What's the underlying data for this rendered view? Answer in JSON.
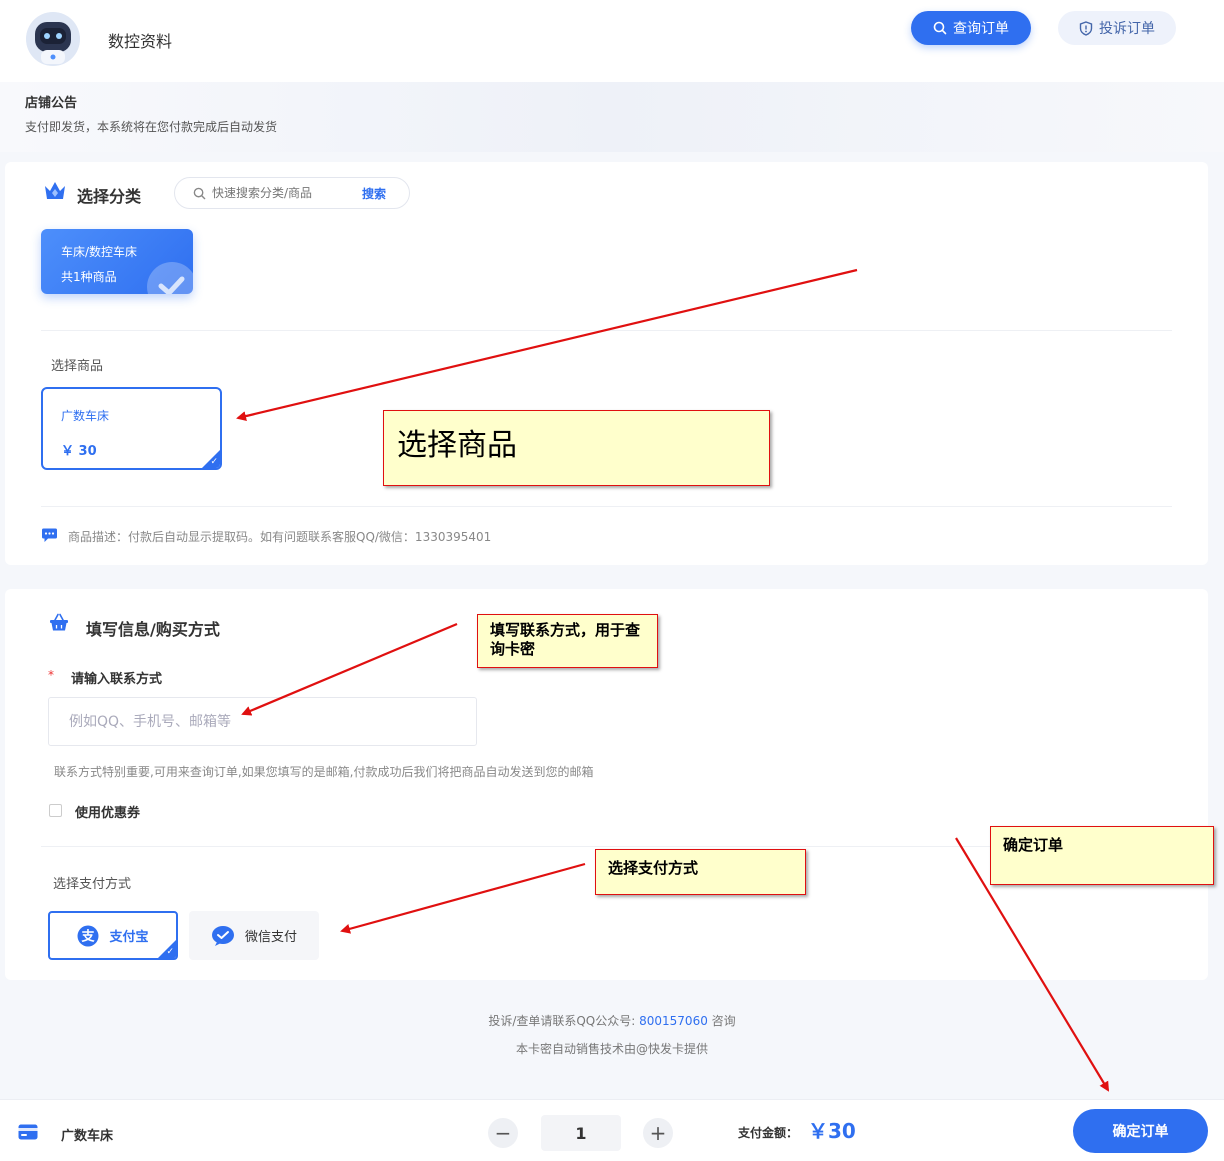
{
  "header": {
    "shop_name": "数控资料",
    "query_button": "查询订单",
    "complain_button": "投诉订单"
  },
  "notice": {
    "title": "店铺公告",
    "text": "支付即发货，本系统将在您付款完成后自动发货"
  },
  "category_section": {
    "title": "选择分类",
    "search_placeholder": "快速搜索分类/商品",
    "search_button": "搜索",
    "categories": [
      {
        "name": "车床/数控车床",
        "count": "共1种商品"
      }
    ]
  },
  "product_section": {
    "title": "选择商品",
    "products": [
      {
        "name": "广数车床",
        "price": "￥ 30"
      }
    ],
    "description": "商品描述：付款后自动显示提取码。如有问题联系客服QQ/微信：1330395401"
  },
  "info_section": {
    "title": "填写信息/购买方式",
    "required_mark": "*",
    "contact_label": "请输入联系方式",
    "contact_placeholder": "例如QQ、手机号、邮箱等",
    "contact_hint": "联系方式特别重要,可用来查询订单,如果您填写的是邮箱,付款成功后我们将把商品自动发送到您的邮箱",
    "coupon_label": "使用优惠券",
    "payment_title": "选择支付方式",
    "payment_methods": [
      {
        "label": "支付宝",
        "icon": "alipay-icon",
        "selected": true
      },
      {
        "label": "微信支付",
        "icon": "wechat-pay-icon",
        "selected": false
      }
    ]
  },
  "footer": {
    "line1_prefix": "投诉/查单请联系QQ公众号:",
    "line1_number": "800157060",
    "line1_suffix": "咨询",
    "line2": "本卡密自动销售技术由@快发卡提供"
  },
  "bottom_bar": {
    "product_name": "广数车床",
    "quantity": "1",
    "minus": "−",
    "plus": "+",
    "amount_label": "支付金额：",
    "amount": "￥30",
    "confirm_button": "确定订单"
  },
  "annotations": {
    "select_product": "选择商品",
    "contact_note": "填写联系方式，用于查询卡密",
    "payment_note": "选择支付方式",
    "confirm_note": "确定订单"
  },
  "colors": {
    "accent": "#2f6ff0",
    "annotation_bg": "#ffffcc",
    "annotation_border": "#e01010"
  }
}
